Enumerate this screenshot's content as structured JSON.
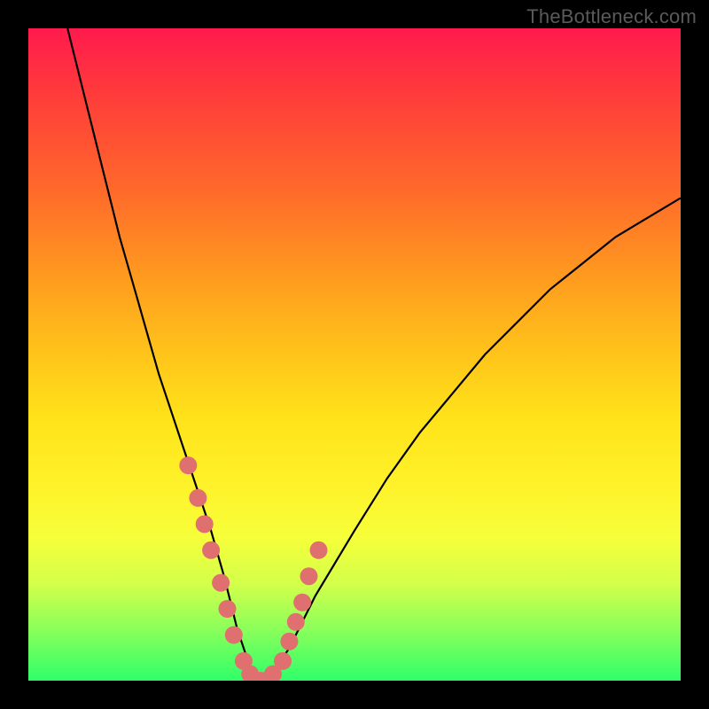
{
  "watermark": "TheBottleneck.com",
  "colors": {
    "curve": "#000000",
    "marker_fill": "#e06f6f",
    "marker_stroke": "#c95a5a",
    "gradient_top": "#ff1a4d",
    "gradient_bottom": "#2fff6a",
    "frame": "#000000"
  },
  "chart_data": {
    "type": "line",
    "title": "",
    "xlabel": "",
    "ylabel": "",
    "xlim": [
      0,
      100
    ],
    "ylim": [
      0,
      100
    ],
    "grid": false,
    "legend": false,
    "series": [
      {
        "name": "bottleneck-curve",
        "x": [
          6,
          8,
          10,
          12,
          14,
          16,
          18,
          20,
          22,
          24,
          26,
          28,
          30,
          31,
          32,
          33,
          34,
          35,
          36,
          38,
          40,
          42,
          44,
          47,
          50,
          55,
          60,
          65,
          70,
          75,
          80,
          85,
          90,
          95,
          100
        ],
        "y": [
          100,
          92,
          84,
          76,
          68,
          61,
          54,
          47,
          41,
          35,
          29,
          23,
          16,
          12,
          8,
          5,
          2,
          0,
          0,
          2,
          5,
          9,
          13,
          18,
          23,
          31,
          38,
          44,
          50,
          55,
          60,
          64,
          68,
          71,
          74
        ]
      }
    ],
    "markers": {
      "name": "highlight-points",
      "x": [
        24.5,
        26,
        27,
        28,
        29.5,
        30.5,
        31.5,
        33,
        34,
        35.5,
        36.5,
        37.5,
        39,
        40,
        41,
        42,
        43,
        44.5
      ],
      "y": [
        33,
        28,
        24,
        20,
        15,
        11,
        7,
        3,
        1,
        0,
        0,
        1,
        3,
        6,
        9,
        12,
        16,
        20
      ]
    }
  }
}
